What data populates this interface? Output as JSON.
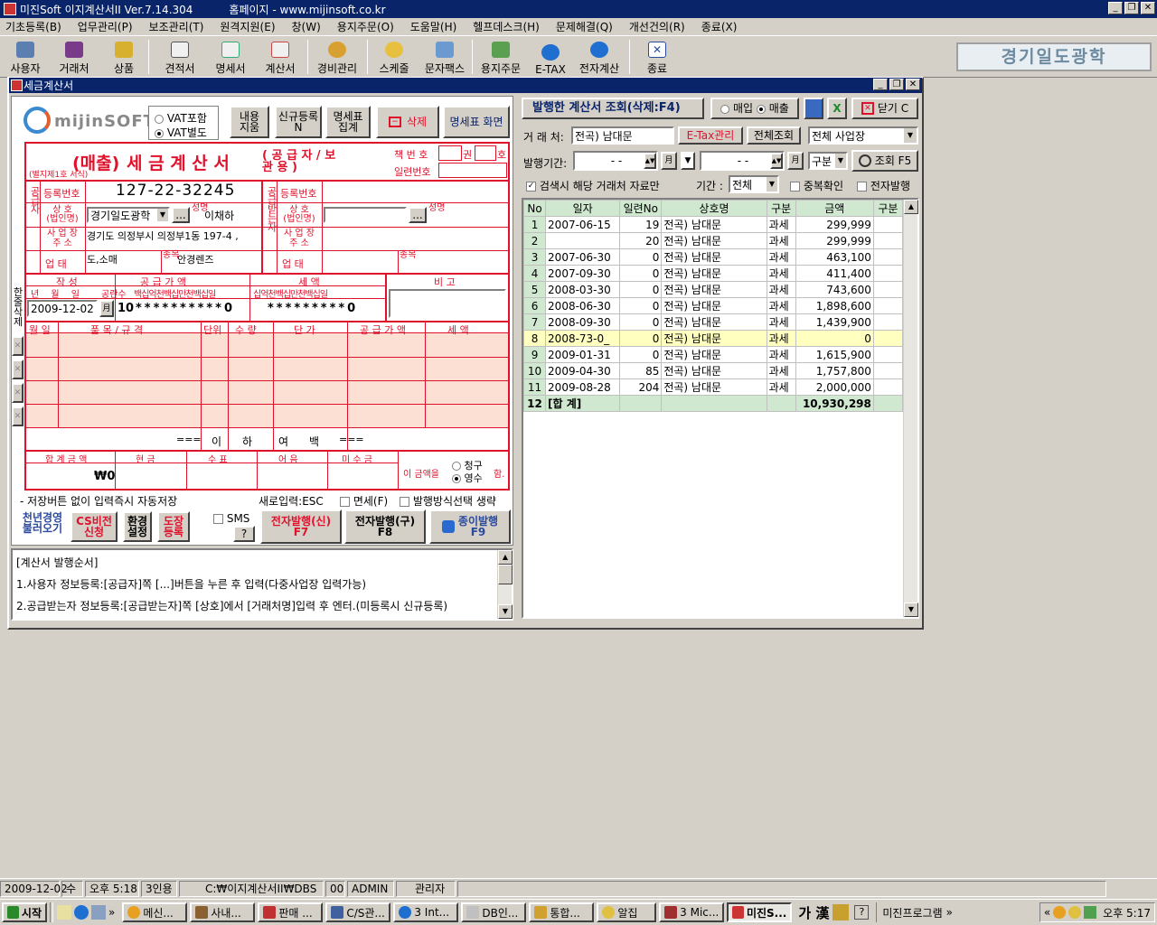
{
  "app": {
    "title": "미진Soft 이지계산서II Ver.7.14.304",
    "homepage": "홈페이지 - www.mijinsoft.co.kr"
  },
  "menu": [
    "기초등록(B)",
    "업무관리(P)",
    "보조관리(T)",
    "원격지원(E)",
    "창(W)",
    "용지주문(O)",
    "도움말(H)",
    "헬프데스크(H)",
    "문제해결(Q)",
    "개선건의(R)",
    "종료(X)"
  ],
  "toolbar": [
    "사용자",
    "거래처",
    "상품",
    "견적서",
    "명세서",
    "계산서",
    "경비관리",
    "스케줄",
    "문자팩스",
    "용지주문",
    "E-TAX",
    "전자계산",
    "종료"
  ],
  "company": "경기일도광학",
  "child": {
    "title": "세금계산서"
  },
  "invoice": {
    "logo": "mijinSOFT",
    "vat_include": "VAT포함",
    "vat_separate": "VAT별도",
    "btn_content": "내용\n지움",
    "btn_new": "신규등록\nN",
    "btn_statement_sum": "명세표\n집계",
    "btn_delete": "삭제",
    "btn_statement_screen": "명세표 화면",
    "title_prefix": "(매출)",
    "title_main": "세 금 계 산 서",
    "title_suffix": "( 공 급 자 / 보 관 용 )",
    "form_note": "(별지제1호 서식)",
    "book_no_label": "책 번 호",
    "book_unit1": "권",
    "book_unit2": "호",
    "serial_label": "일련번호",
    "supplier": {
      "reg_label": "등록번호",
      "reg_no": "127-22-32245",
      "name_label": "상 호\n(법인명)",
      "name": "경기일도광학",
      "ceo_label": "성명",
      "ceo": "이채하",
      "addr_label": "사 업 장\n주 소",
      "addr": "경기도 의정부시 의정부1동 197-4 ,",
      "type_label": "업 태",
      "type": "도,소매",
      "item_label": "종목",
      "item": "안경렌즈"
    },
    "side_supplier": "공급자",
    "side_receiver": "공급받는자",
    "receiver": {
      "reg_label": "등록번호",
      "name_label": "상 호\n(법인명)",
      "ceo_label": "성명",
      "addr_label": "사 업 장\n주 소",
      "type_label": "업 태",
      "item_label": "종목"
    },
    "write_label": "작 성",
    "supply_label": "공 급 가 액",
    "tax_label": "세 액",
    "remark_label": "비 고",
    "date_cols": [
      "년",
      "월",
      "일",
      "공란수"
    ],
    "digit_cols": [
      "백",
      "십",
      "억",
      "천",
      "백",
      "십",
      "만",
      "천",
      "백",
      "십",
      "일"
    ],
    "date": "2009-12-02",
    "blank_count": "10",
    "supply_digits": "**********0",
    "tax_digits": "*********0",
    "items_headers": [
      "월 일",
      "품 목 / 규 격",
      "단위",
      "수 량",
      "단 가",
      "공 급 가 액",
      "세 액"
    ],
    "words": [
      "===",
      "이",
      "하",
      "여",
      "백",
      "==="
    ],
    "total_headers": [
      "합 계 금 액",
      "현 금",
      "수 표",
      "어 음",
      "미 수 금"
    ],
    "total": "₩0",
    "amount_label": "이 금액을",
    "claim": "청구",
    "receipt": "영수",
    "suffix": "함.",
    "side_delete": "한줄삭제",
    "autosave_note": "- 저장버튼 없이 입력즉시 자동저장",
    "new_input": "새로입력:ESC",
    "tax_free": "면세(F)",
    "skip_method": "발행방식선택 생략",
    "btn_cheon": "천년경영\n불러오기",
    "btn_cs": "CS비전\n신청",
    "btn_env": "환경\n설정",
    "btn_stamp": "도장\n등록",
    "sms": "SMS",
    "sms_help": "?",
    "btn_e_new": "전자발행(신)\nF7",
    "btn_e_old": "전자발행(구)\nF8",
    "btn_paper": "종이발행\nF9",
    "guide": [
      "[계산서 발행순서]",
      "1.사용자 정보등록:[공급자]쪽 [...]버튼을 누른 후 입력(다중사업장 입력가능)",
      "2.공급받는자 정보등록:[공급받는자]쪽 [상호]에서 [거래처명]입력 후 엔터.(미등록시 신규등록)"
    ]
  },
  "list": {
    "title": "발행한 계산서 조회(삭제:F4)",
    "buy": "매입",
    "sell": "매출",
    "close": "닫기 C",
    "customer_label": "거 래 처:",
    "customer": "전곡) 남대문",
    "etax": "E-Tax관리",
    "all_view": "전체조회",
    "site": "전체 사업장",
    "period_label": "발행기간:",
    "date_blank": "-   -",
    "gubun": "구분",
    "search": "조회 F5",
    "only_customer": "검색시 해당 거래처 자료만",
    "term_label": "기간 :",
    "term": "전체",
    "dup_check": "중복확인",
    "e_issue": "전자발행",
    "headers": [
      "No",
      "일자",
      "일련No",
      "상호명",
      "구분",
      "금액",
      "구분"
    ],
    "rows": [
      [
        "1",
        "2007-06-15",
        "19",
        "전곡) 남대문",
        "과세",
        "299,999",
        ""
      ],
      [
        "2",
        "",
        "20",
        "전곡) 남대문",
        "과세",
        "299,999",
        ""
      ],
      [
        "3",
        "2007-06-30",
        "0",
        "전곡) 남대문",
        "과세",
        "463,100",
        ""
      ],
      [
        "4",
        "2007-09-30",
        "0",
        "전곡) 남대문",
        "과세",
        "411,400",
        ""
      ],
      [
        "5",
        "2008-03-30",
        "0",
        "전곡) 남대문",
        "과세",
        "743,600",
        ""
      ],
      [
        "6",
        "2008-06-30",
        "0",
        "전곡) 남대문",
        "과세",
        "1,898,600",
        ""
      ],
      [
        "7",
        "2008-09-30",
        "0",
        "전곡) 남대문",
        "과세",
        "1,439,900",
        ""
      ],
      [
        "8",
        "2008-73-0_",
        "0",
        "전곡) 남대문",
        "과세",
        "0",
        ""
      ],
      [
        "9",
        "2009-01-31",
        "0",
        "전곡) 남대문",
        "과세",
        "1,615,900",
        ""
      ],
      [
        "10",
        "2009-04-30",
        "85",
        "전곡) 남대문",
        "과세",
        "1,757,800",
        ""
      ],
      [
        "11",
        "2009-08-28",
        "204",
        "전곡) 남대문",
        "과세",
        "2,000,000",
        ""
      ]
    ],
    "total_no": "12",
    "total_label": "[합 계]",
    "total_amount": "10,930,298"
  },
  "status": [
    "2009-12-02",
    "수",
    "오후 5:18",
    "3인용",
    "C:₩이지계산서II₩DBS",
    "00",
    "ADMIN",
    "관리자"
  ],
  "taskbar": {
    "start": "시작",
    "items": [
      "메신...",
      "사내...",
      "판매 ...",
      "C/S관...",
      "3 Int...",
      "DB인...",
      "통합...",
      "알집",
      "3 Mic...",
      "미진S..."
    ],
    "ime": "가 漢",
    "tray_label": "미진프로그램",
    "clock": "오후 5:17"
  },
  "colors": {
    "titlebar": "#0a246a",
    "red": "#e0112b",
    "grid_header": "#cfe8cf",
    "selected_row": "#ffffc0",
    "pink": "#fce0d4"
  }
}
